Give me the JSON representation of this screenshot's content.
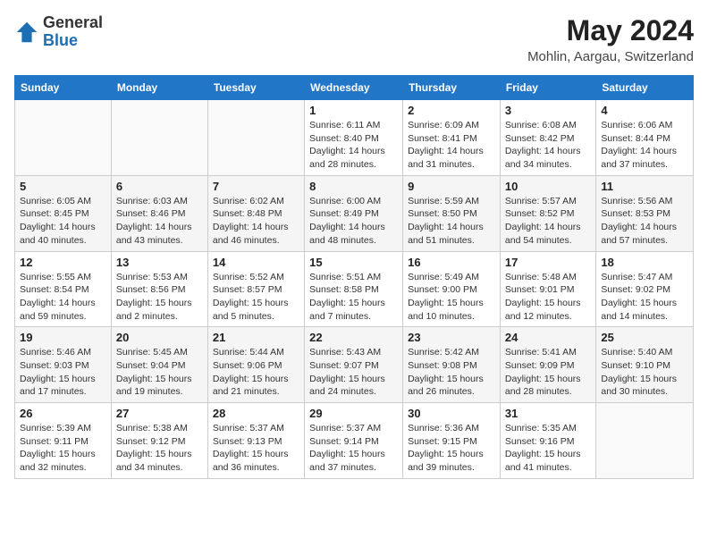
{
  "logo": {
    "general": "General",
    "blue": "Blue"
  },
  "header": {
    "month_year": "May 2024",
    "location": "Mohlin, Aargau, Switzerland"
  },
  "weekdays": [
    "Sunday",
    "Monday",
    "Tuesday",
    "Wednesday",
    "Thursday",
    "Friday",
    "Saturday"
  ],
  "weeks": [
    [
      {
        "day": "",
        "info": ""
      },
      {
        "day": "",
        "info": ""
      },
      {
        "day": "",
        "info": ""
      },
      {
        "day": "1",
        "info": "Sunrise: 6:11 AM\nSunset: 8:40 PM\nDaylight: 14 hours and 28 minutes."
      },
      {
        "day": "2",
        "info": "Sunrise: 6:09 AM\nSunset: 8:41 PM\nDaylight: 14 hours and 31 minutes."
      },
      {
        "day": "3",
        "info": "Sunrise: 6:08 AM\nSunset: 8:42 PM\nDaylight: 14 hours and 34 minutes."
      },
      {
        "day": "4",
        "info": "Sunrise: 6:06 AM\nSunset: 8:44 PM\nDaylight: 14 hours and 37 minutes."
      }
    ],
    [
      {
        "day": "5",
        "info": "Sunrise: 6:05 AM\nSunset: 8:45 PM\nDaylight: 14 hours and 40 minutes."
      },
      {
        "day": "6",
        "info": "Sunrise: 6:03 AM\nSunset: 8:46 PM\nDaylight: 14 hours and 43 minutes."
      },
      {
        "day": "7",
        "info": "Sunrise: 6:02 AM\nSunset: 8:48 PM\nDaylight: 14 hours and 46 minutes."
      },
      {
        "day": "8",
        "info": "Sunrise: 6:00 AM\nSunset: 8:49 PM\nDaylight: 14 hours and 48 minutes."
      },
      {
        "day": "9",
        "info": "Sunrise: 5:59 AM\nSunset: 8:50 PM\nDaylight: 14 hours and 51 minutes."
      },
      {
        "day": "10",
        "info": "Sunrise: 5:57 AM\nSunset: 8:52 PM\nDaylight: 14 hours and 54 minutes."
      },
      {
        "day": "11",
        "info": "Sunrise: 5:56 AM\nSunset: 8:53 PM\nDaylight: 14 hours and 57 minutes."
      }
    ],
    [
      {
        "day": "12",
        "info": "Sunrise: 5:55 AM\nSunset: 8:54 PM\nDaylight: 14 hours and 59 minutes."
      },
      {
        "day": "13",
        "info": "Sunrise: 5:53 AM\nSunset: 8:56 PM\nDaylight: 15 hours and 2 minutes."
      },
      {
        "day": "14",
        "info": "Sunrise: 5:52 AM\nSunset: 8:57 PM\nDaylight: 15 hours and 5 minutes."
      },
      {
        "day": "15",
        "info": "Sunrise: 5:51 AM\nSunset: 8:58 PM\nDaylight: 15 hours and 7 minutes."
      },
      {
        "day": "16",
        "info": "Sunrise: 5:49 AM\nSunset: 9:00 PM\nDaylight: 15 hours and 10 minutes."
      },
      {
        "day": "17",
        "info": "Sunrise: 5:48 AM\nSunset: 9:01 PM\nDaylight: 15 hours and 12 minutes."
      },
      {
        "day": "18",
        "info": "Sunrise: 5:47 AM\nSunset: 9:02 PM\nDaylight: 15 hours and 14 minutes."
      }
    ],
    [
      {
        "day": "19",
        "info": "Sunrise: 5:46 AM\nSunset: 9:03 PM\nDaylight: 15 hours and 17 minutes."
      },
      {
        "day": "20",
        "info": "Sunrise: 5:45 AM\nSunset: 9:04 PM\nDaylight: 15 hours and 19 minutes."
      },
      {
        "day": "21",
        "info": "Sunrise: 5:44 AM\nSunset: 9:06 PM\nDaylight: 15 hours and 21 minutes."
      },
      {
        "day": "22",
        "info": "Sunrise: 5:43 AM\nSunset: 9:07 PM\nDaylight: 15 hours and 24 minutes."
      },
      {
        "day": "23",
        "info": "Sunrise: 5:42 AM\nSunset: 9:08 PM\nDaylight: 15 hours and 26 minutes."
      },
      {
        "day": "24",
        "info": "Sunrise: 5:41 AM\nSunset: 9:09 PM\nDaylight: 15 hours and 28 minutes."
      },
      {
        "day": "25",
        "info": "Sunrise: 5:40 AM\nSunset: 9:10 PM\nDaylight: 15 hours and 30 minutes."
      }
    ],
    [
      {
        "day": "26",
        "info": "Sunrise: 5:39 AM\nSunset: 9:11 PM\nDaylight: 15 hours and 32 minutes."
      },
      {
        "day": "27",
        "info": "Sunrise: 5:38 AM\nSunset: 9:12 PM\nDaylight: 15 hours and 34 minutes."
      },
      {
        "day": "28",
        "info": "Sunrise: 5:37 AM\nSunset: 9:13 PM\nDaylight: 15 hours and 36 minutes."
      },
      {
        "day": "29",
        "info": "Sunrise: 5:37 AM\nSunset: 9:14 PM\nDaylight: 15 hours and 37 minutes."
      },
      {
        "day": "30",
        "info": "Sunrise: 5:36 AM\nSunset: 9:15 PM\nDaylight: 15 hours and 39 minutes."
      },
      {
        "day": "31",
        "info": "Sunrise: 5:35 AM\nSunset: 9:16 PM\nDaylight: 15 hours and 41 minutes."
      },
      {
        "day": "",
        "info": ""
      }
    ]
  ]
}
